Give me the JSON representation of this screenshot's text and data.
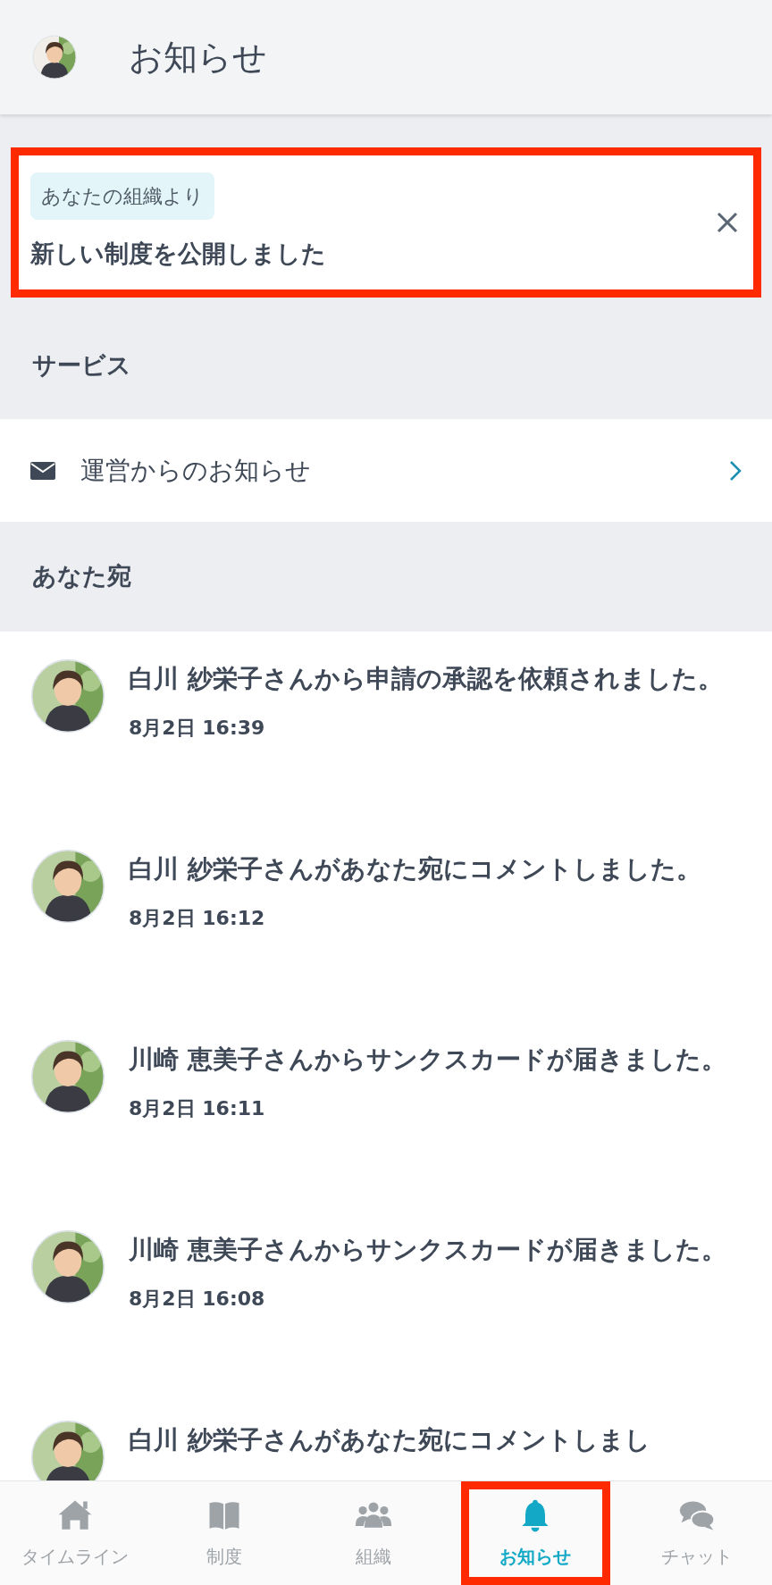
{
  "header": {
    "title": "お知らせ"
  },
  "banner": {
    "tag": "あなたの組織より",
    "title": "新しい制度を公開しました",
    "highlighted": true
  },
  "sections": [
    {
      "title": "サービス",
      "items": [
        {
          "kind": "link",
          "label": "運営からのお知らせ"
        }
      ]
    },
    {
      "title": "あなた宛",
      "items": [
        {
          "kind": "notification",
          "text": "白川 紗栄子さんから申請の承認を依頼されました。",
          "time": "8月2日 16:39"
        },
        {
          "kind": "notification",
          "text": "白川 紗栄子さんがあなた宛にコメントしました。",
          "time": "8月2日 16:12"
        },
        {
          "kind": "notification",
          "text": "川崎 恵美子さんからサンクスカードが届きました。",
          "time": "8月2日 16:11"
        },
        {
          "kind": "notification",
          "text": "川崎 恵美子さんからサンクスカードが届きました。",
          "time": "8月2日 16:08"
        },
        {
          "kind": "notification",
          "text": "白川 紗栄子さんがあなた宛にコメントしまし"
        }
      ]
    }
  ],
  "nav": [
    {
      "label": "タイムライン",
      "selected": false,
      "highlighted": false
    },
    {
      "label": "制度",
      "selected": false,
      "highlighted": false
    },
    {
      "label": "組織",
      "selected": false,
      "highlighted": false
    },
    {
      "label": "お知らせ",
      "selected": true,
      "highlighted": true
    },
    {
      "label": "チャット",
      "selected": false,
      "highlighted": false
    }
  ]
}
